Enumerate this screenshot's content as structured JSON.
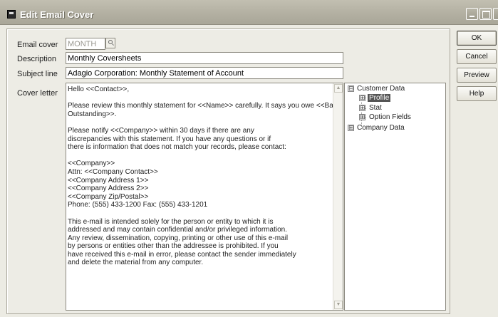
{
  "window": {
    "title": "Edit Email Cover"
  },
  "form": {
    "email_cover_label": "Email cover",
    "email_cover_value": "MONTH",
    "description_label": "Description",
    "description_value": "Monthly Coversheets",
    "subject_label": "Subject line",
    "subject_value": "Adagio Corporation: Monthly Statement of Account",
    "cover_letter_label": "Cover letter",
    "cover_letter_lines": [
      "Hello <<Contact>>,",
      "",
      "Please review this monthly statement for <<Name>> carefully.  It says you owe <<Balance",
      "Outstanding>>.",
      "",
      "Please notify <<Company>> within 30 days if there are any",
      "discrepancies with this statement. If you have any questions or if",
      "there is information that does not match your records, please contact:",
      "",
      "<<Company>>",
      "Attn:  <<Company Contact>>",
      "<<Company Address 1>>",
      "<<Company Address 2>>",
      "<<Company Zip/Postal>>",
      "Phone: (555) 433-1200     Fax: (555) 433-1201",
      "",
      "This e-mail is intended solely for the person or entity to which it is",
      "addressed and may contain confidential and/or privileged information.",
      "Any review, dissemination, copying, printing or other use of this e-mail",
      "by persons or entities other than the addressee is prohibited. If you",
      "have received this e-mail in error, please contact the sender immediately",
      "and delete the material from any computer."
    ]
  },
  "tree": {
    "customer_data": "Customer Data",
    "profile": "Profile",
    "stat": "Stat",
    "option_fields": "Option Fields",
    "company_data": "Company Data",
    "expanded_sign": "⊟",
    "collapsed_sign": "⊞"
  },
  "buttons": {
    "ok": "OK",
    "cancel": "Cancel",
    "preview": "Preview",
    "help": "Help"
  },
  "icons": {
    "scroll_up": "▲",
    "scroll_down": "▼"
  }
}
